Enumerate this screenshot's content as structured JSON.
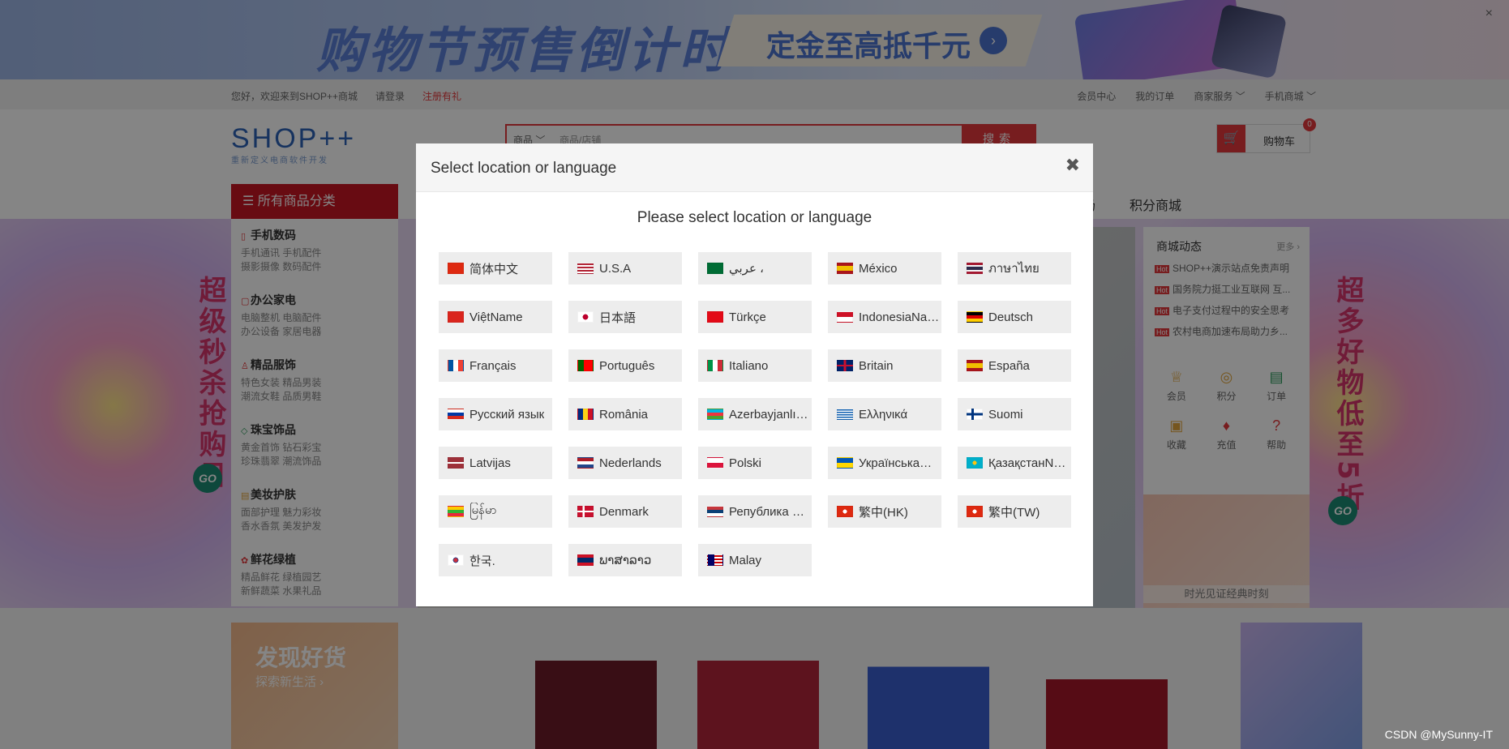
{
  "banner": {
    "title": "购物节预售倒计时",
    "subtitle": "定金至高抵千元",
    "go": "›",
    "close": "×"
  },
  "topbar": {
    "welcome": "您好，欢迎来到SHOP++商城",
    "login": "请登录",
    "register": "注册有礼",
    "member_center": "会员中心",
    "my_orders": "我的订单",
    "merchant": "商家服务 ﹀",
    "mobile": "手机商城 ﹀"
  },
  "header": {
    "logo": "SHOP++",
    "logo_sub": "重新定义电商软件开发",
    "search_category": "商品 ﹀",
    "search_placeholder": "商品/店铺",
    "search_button": "搜索",
    "cart_label": "购物车",
    "cart_count": "0"
  },
  "nav": {
    "all_categories": "☰ 所有商品分类",
    "links": [
      "场",
      "积分商城"
    ]
  },
  "categories": [
    {
      "title": "手机数码",
      "subs": [
        "手机通讯 手机配件",
        "摄影摄像 数码配件"
      ]
    },
    {
      "title": "办公家电",
      "subs": [
        "电脑整机 电脑配件",
        "办公设备 家居电器"
      ]
    },
    {
      "title": "精品服饰",
      "subs": [
        "特色女装 精品男装",
        "潮流女鞋 品质男鞋"
      ]
    },
    {
      "title": "珠宝饰品",
      "subs": [
        "黄金首饰 钻石彩宝",
        "珍珠翡翠 潮流饰品"
      ]
    },
    {
      "title": "美妆护肤",
      "subs": [
        "面部护理 魅力彩妆",
        "香水香氛 美发护发"
      ]
    },
    {
      "title": "鲜花绿植",
      "subs": [
        "精品鲜花 绿植园艺",
        "新鲜蔬菜 水果礼品"
      ]
    }
  ],
  "promos": {
    "left": "超级秒杀抢购日",
    "right": "超多好物低至5折",
    "go": "GO"
  },
  "sidebox": {
    "title": "商城动态",
    "more": "更多 ›",
    "hot": "Hot",
    "news": [
      "SHOP++演示站点免责声明",
      "国务院力挺工业互联网 互...",
      "电子支付过程中的安全思考",
      "农村电商加速布局助力乡..."
    ],
    "quick": [
      "会员",
      "积分",
      "订单",
      "收藏",
      "充值",
      "帮助"
    ],
    "watch_caption": "时光见证经典时刻"
  },
  "bottom": {
    "discover_title": "发现好货",
    "discover_sub": "探索新生活 ›"
  },
  "watermark": "CSDN @MySunny-IT",
  "modal": {
    "title": "Select location or language",
    "close": "✖",
    "heading": "Please select location or language",
    "languages": [
      {
        "label": "简体中文",
        "flag": "cn"
      },
      {
        "label": "U.S.A",
        "flag": "us"
      },
      {
        "label": "عربي ،",
        "flag": "sa"
      },
      {
        "label": "México",
        "flag": "es"
      },
      {
        "label": "ภาษาไทย",
        "flag": "th"
      },
      {
        "label": "ViệtName",
        "flag": "vn"
      },
      {
        "label": "日本語",
        "flag": "jp"
      },
      {
        "label": "Türkçe",
        "flag": "tr"
      },
      {
        "label": "IndonesiaNa…",
        "flag": "id"
      },
      {
        "label": "Deutsch",
        "flag": "de"
      },
      {
        "label": "Français",
        "flag": "fr"
      },
      {
        "label": "Português",
        "flag": "pt"
      },
      {
        "label": "Italiano",
        "flag": "it"
      },
      {
        "label": "Britain",
        "flag": "gb"
      },
      {
        "label": "España",
        "flag": "es"
      },
      {
        "label": "Русский язык",
        "flag": "ru"
      },
      {
        "label": "România",
        "flag": "ro"
      },
      {
        "label": "AzerbayjanlıN…",
        "flag": "az"
      },
      {
        "label": "Ελληνικά",
        "flag": "gr"
      },
      {
        "label": "Suomi",
        "flag": "fi"
      },
      {
        "label": "Latvijas",
        "flag": "lv"
      },
      {
        "label": "Nederlands",
        "flag": "nl"
      },
      {
        "label": "Polski",
        "flag": "pl"
      },
      {
        "label": "УкраїнськаN…",
        "flag": "ua"
      },
      {
        "label": "ҚазақстанNa…",
        "flag": "kz"
      },
      {
        "label": "မြန်မာ",
        "flag": "mm"
      },
      {
        "label": "Denmark",
        "flag": "dk"
      },
      {
        "label": "Република С…",
        "flag": "rs"
      },
      {
        "label": "繁中(HK)",
        "flag": "hk"
      },
      {
        "label": "繁中(TW)",
        "flag": "hk"
      },
      {
        "label": "한국.",
        "flag": "kr"
      },
      {
        "label": "ພາສາລາວ",
        "flag": "la"
      },
      {
        "label": "Malay",
        "flag": "my"
      }
    ]
  },
  "colors": {
    "accent": "#e4393c",
    "category_bar": "#c81623",
    "overlay": "rgba(0,0,0,0.48)",
    "lang_button_bg": "#ededed"
  }
}
